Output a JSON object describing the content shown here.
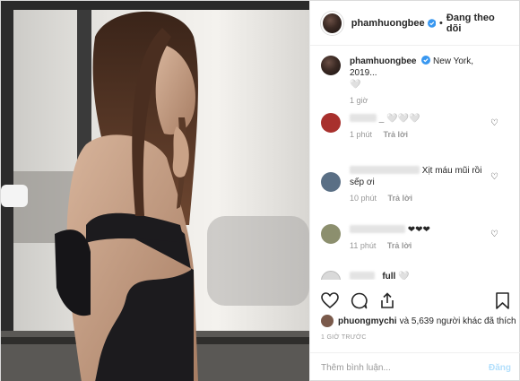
{
  "header": {
    "username": "phamhuongbee",
    "follow_label": "Đang theo dõi"
  },
  "caption": {
    "username": "phamhuongbee",
    "text": "New York, 2019...",
    "emoji": "🤍",
    "time": "1 giờ"
  },
  "comments": [
    {
      "username_visible": "_",
      "text": "🤍🤍🤍",
      "time": "1 phút",
      "reply_label": "Trả lời"
    },
    {
      "username_visible": "",
      "text": "Xịt máu mũi rồi sếp ơi",
      "time": "10 phút",
      "reply_label": "Trả lời"
    },
    {
      "username_visible": "",
      "text": "❤❤❤",
      "time": "11 phút",
      "reply_label": "Trả lời"
    },
    {
      "username_visible": "_full",
      "text": "🤍",
      "time": "",
      "reply_label": ""
    }
  ],
  "likes": {
    "first_user": "phuongmychi",
    "rest": "và 5,639 người khác đã thích"
  },
  "timestamp": "1 GIỜ TRƯỚC",
  "add_comment": {
    "placeholder": "Thêm bình luận...",
    "post_label": "Đăng"
  },
  "colors": {
    "verified": "#3897f0",
    "text": "#262626",
    "muted": "#999999",
    "post_disabled": "#b2dffc"
  }
}
